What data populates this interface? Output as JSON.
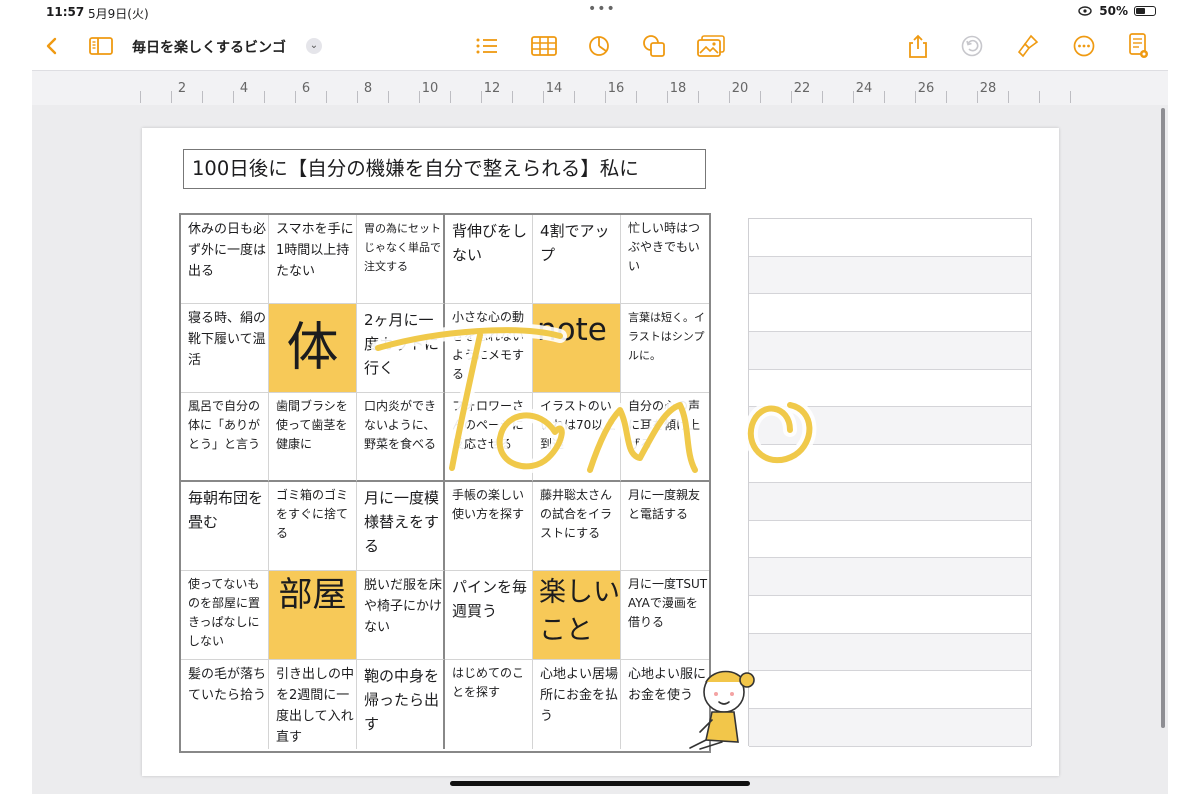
{
  "status_bar": {
    "time": "11:57",
    "date": "5月9日(火)",
    "battery": "50%",
    "battery_level": 0.5
  },
  "toolbar": {
    "title": "毎日を楽しくするビンゴ",
    "icons": [
      "back-chevron-icon",
      "sidebar-icon",
      "title-chevron-icon",
      "list-icon",
      "table-icon",
      "chart-icon",
      "shape-icon",
      "media-icon",
      "share-icon",
      "undo-icon",
      "format-brush-icon",
      "more-icon",
      "document-icon"
    ],
    "accent_color": "#ef9a12"
  },
  "ruler": {
    "labels": [
      "2",
      "4",
      "6",
      "8",
      "10",
      "12",
      "14",
      "16",
      "18",
      "20",
      "22",
      "24",
      "26",
      "28"
    ]
  },
  "page": {
    "headline": "100日後に【自分の機嫌を自分で整えられる】私に",
    "bingo": [
      [
        "休みの日も必ず外に一度は出る",
        "スマホを手に1時間以上持たない",
        "胃の為にセットじゃなく単品で注文する",
        "背伸びをしない",
        "4割でアップ",
        "忙しい時はつぶやきでもいい"
      ],
      [
        "寝る時、絹の靴下履いて温活",
        "体",
        "2ヶ月に一度カットに行く",
        "小さな心の動きを忘れないようにメモする",
        "note",
        "言葉は短く。イラストはシンプルに。"
      ],
      [
        "風呂で自分の体に「ありがとう」と言う",
        "歯間ブラシを使って歯茎を健康に",
        "口内炎ができないように、野菜を食べる",
        "フォロワーさんのページに反応させる",
        "イラストのいいねは70以上到達",
        "自分の心の声に耳を傾け上げる"
      ],
      [
        "毎朝布団を畳む",
        "ゴミ箱のゴミをすぐに捨てる",
        "月に一度模様替えをする",
        "手帳の楽しい使い方を探す",
        "藤井聡太さんの試合をイラストにする",
        "月に一度親友と電話する"
      ],
      [
        "使ってないものを部屋に置きっぱなしにしない",
        "部屋",
        "脱いだ服を床や椅子にかけない",
        "パインを毎週買う",
        "楽しいこと",
        "月に一度TSUTAYAで漫画を借りる"
      ],
      [
        "髪の毛が落ちていたら拾う",
        "引き出しの中を2週間に一度出して入れ直す",
        "鞄の中身を帰ったら出す",
        "はじめてのことを探す",
        "心地よい居場所にお金を払う",
        "心地よい服にお金を使う"
      ]
    ],
    "highlight_color": "#f7c958",
    "watermark": "Tomo",
    "watermark_color": "#f0c94a"
  }
}
